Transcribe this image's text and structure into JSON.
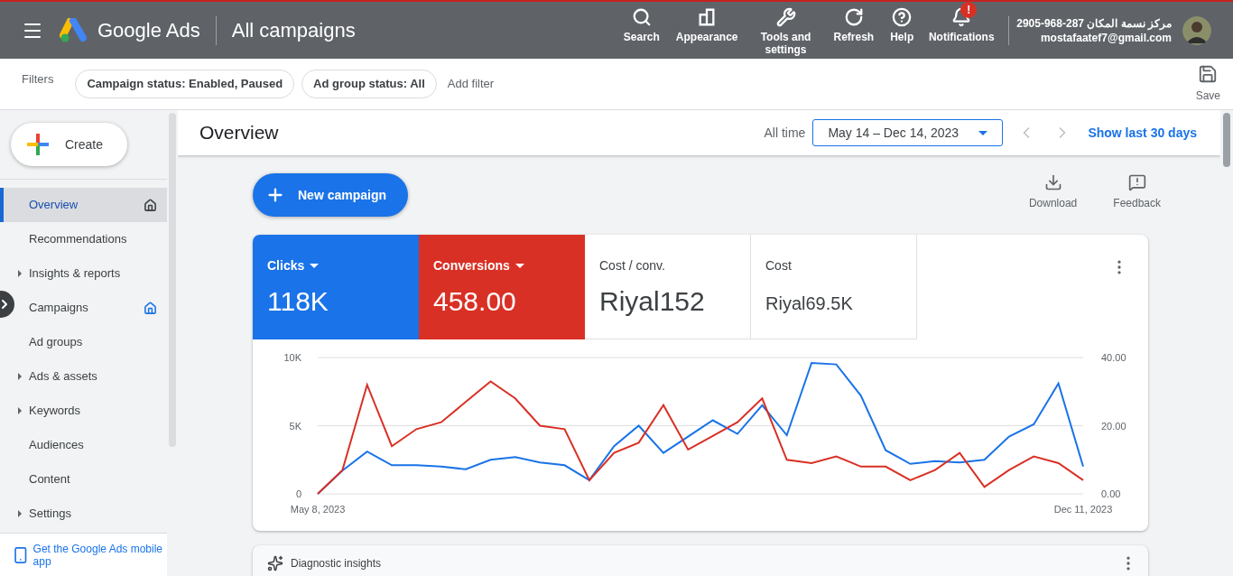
{
  "header": {
    "product": "Google Ads",
    "title": "All campaigns",
    "actions": [
      {
        "kind": "search",
        "label": "Search"
      },
      {
        "kind": "appearance",
        "label": "Appearance"
      },
      {
        "kind": "tools",
        "label": "Tools and settings"
      },
      {
        "kind": "refresh",
        "label": "Refresh"
      },
      {
        "kind": "help",
        "label": "Help"
      },
      {
        "kind": "notifications",
        "label": "Notifications",
        "badge": "!"
      }
    ],
    "account": {
      "name": "مركز نسمة المكان 287-968-2905",
      "email": "mostafaatef7@gmail.com"
    }
  },
  "filters": {
    "label": "Filters",
    "chips": [
      "Campaign status: Enabled, Paused",
      "Ad group status: All"
    ],
    "add": "Add filter",
    "save": "Save"
  },
  "sidebar": {
    "create": "Create",
    "items": [
      {
        "label": "Overview",
        "kind": "link",
        "selected": true,
        "home_icon": true
      },
      {
        "label": "Recommendations",
        "kind": "link",
        "selected": false,
        "home_icon": false
      },
      {
        "label": "Insights & reports",
        "kind": "expandable",
        "selected": false,
        "home_icon": false
      },
      {
        "label": "Campaigns",
        "kind": "link",
        "selected": false,
        "home_icon": true
      },
      {
        "label": "Ad groups",
        "kind": "link",
        "selected": false,
        "home_icon": false
      },
      {
        "label": "Ads & assets",
        "kind": "expandable",
        "selected": false,
        "home_icon": false
      },
      {
        "label": "Keywords",
        "kind": "expandable",
        "selected": false,
        "home_icon": false
      },
      {
        "label": "Audiences",
        "kind": "link",
        "selected": false,
        "home_icon": false
      },
      {
        "label": "Content",
        "kind": "link",
        "selected": false,
        "home_icon": false
      },
      {
        "label": "Settings",
        "kind": "expandable",
        "selected": false,
        "home_icon": false
      }
    ],
    "footer": "Get the Google Ads mobile app"
  },
  "page": {
    "title": "Overview",
    "range_label": "All time",
    "date_range": "May 14 – Dec 14, 2023",
    "show_last": "Show last 30 days",
    "new_campaign": "New campaign",
    "download": "Download",
    "feedback": "Feedback"
  },
  "metrics": [
    {
      "label": "Clicks",
      "value": "118K",
      "selected": true,
      "color": "#1a73e8"
    },
    {
      "label": "Conversions",
      "value": "458.00",
      "selected": true,
      "color": "#d93025"
    },
    {
      "label": "Cost / conv.",
      "value": "Riyal152",
      "selected": false
    },
    {
      "label": "Cost",
      "value": "Riyal69.5K",
      "selected": false
    }
  ],
  "chart_data": {
    "type": "line",
    "categories": [
      "May 8, 2023",
      null,
      null,
      null,
      null,
      null,
      null,
      null,
      null,
      null,
      null,
      null,
      null,
      null,
      null,
      null,
      null,
      null,
      null,
      null,
      null,
      null,
      null,
      null,
      null,
      null,
      null,
      null,
      null,
      null,
      null,
      "Dec 11, 2023"
    ],
    "ylim": [
      0,
      10000
    ],
    "yticks": [
      {
        "value": 0,
        "label": "0"
      },
      {
        "value": 5000,
        "label": "5K"
      },
      {
        "value": 10000,
        "label": "10K"
      }
    ],
    "y2lim": [
      0,
      40
    ],
    "y2ticks": [
      {
        "value": 0,
        "label": "0.00"
      },
      {
        "value": 20,
        "label": "20.00"
      },
      {
        "value": 40,
        "label": "40.00"
      }
    ],
    "series": [
      {
        "color": "#1a73e8",
        "values": [
          0,
          1700,
          3100,
          2100,
          2100,
          2000,
          1800,
          2500,
          2700,
          2300,
          2100,
          1000,
          3500,
          5000,
          3000,
          4200,
          5400,
          4400,
          6500,
          4300,
          9600,
          9500,
          7200,
          3200,
          2200,
          2400,
          2300,
          2500,
          4200,
          5100,
          8100,
          2000
        ]
      },
      {
        "color": "#d93025",
        "axis": "y2",
        "values": [
          0,
          7,
          32,
          14,
          19,
          21,
          27,
          33,
          28,
          20,
          19,
          4,
          12,
          15,
          26,
          13,
          17,
          21,
          28,
          10,
          9,
          11,
          8,
          8,
          4,
          7,
          12,
          2,
          7,
          11,
          9,
          4
        ]
      }
    ]
  },
  "insights": {
    "title": "Diagnostic insights"
  }
}
